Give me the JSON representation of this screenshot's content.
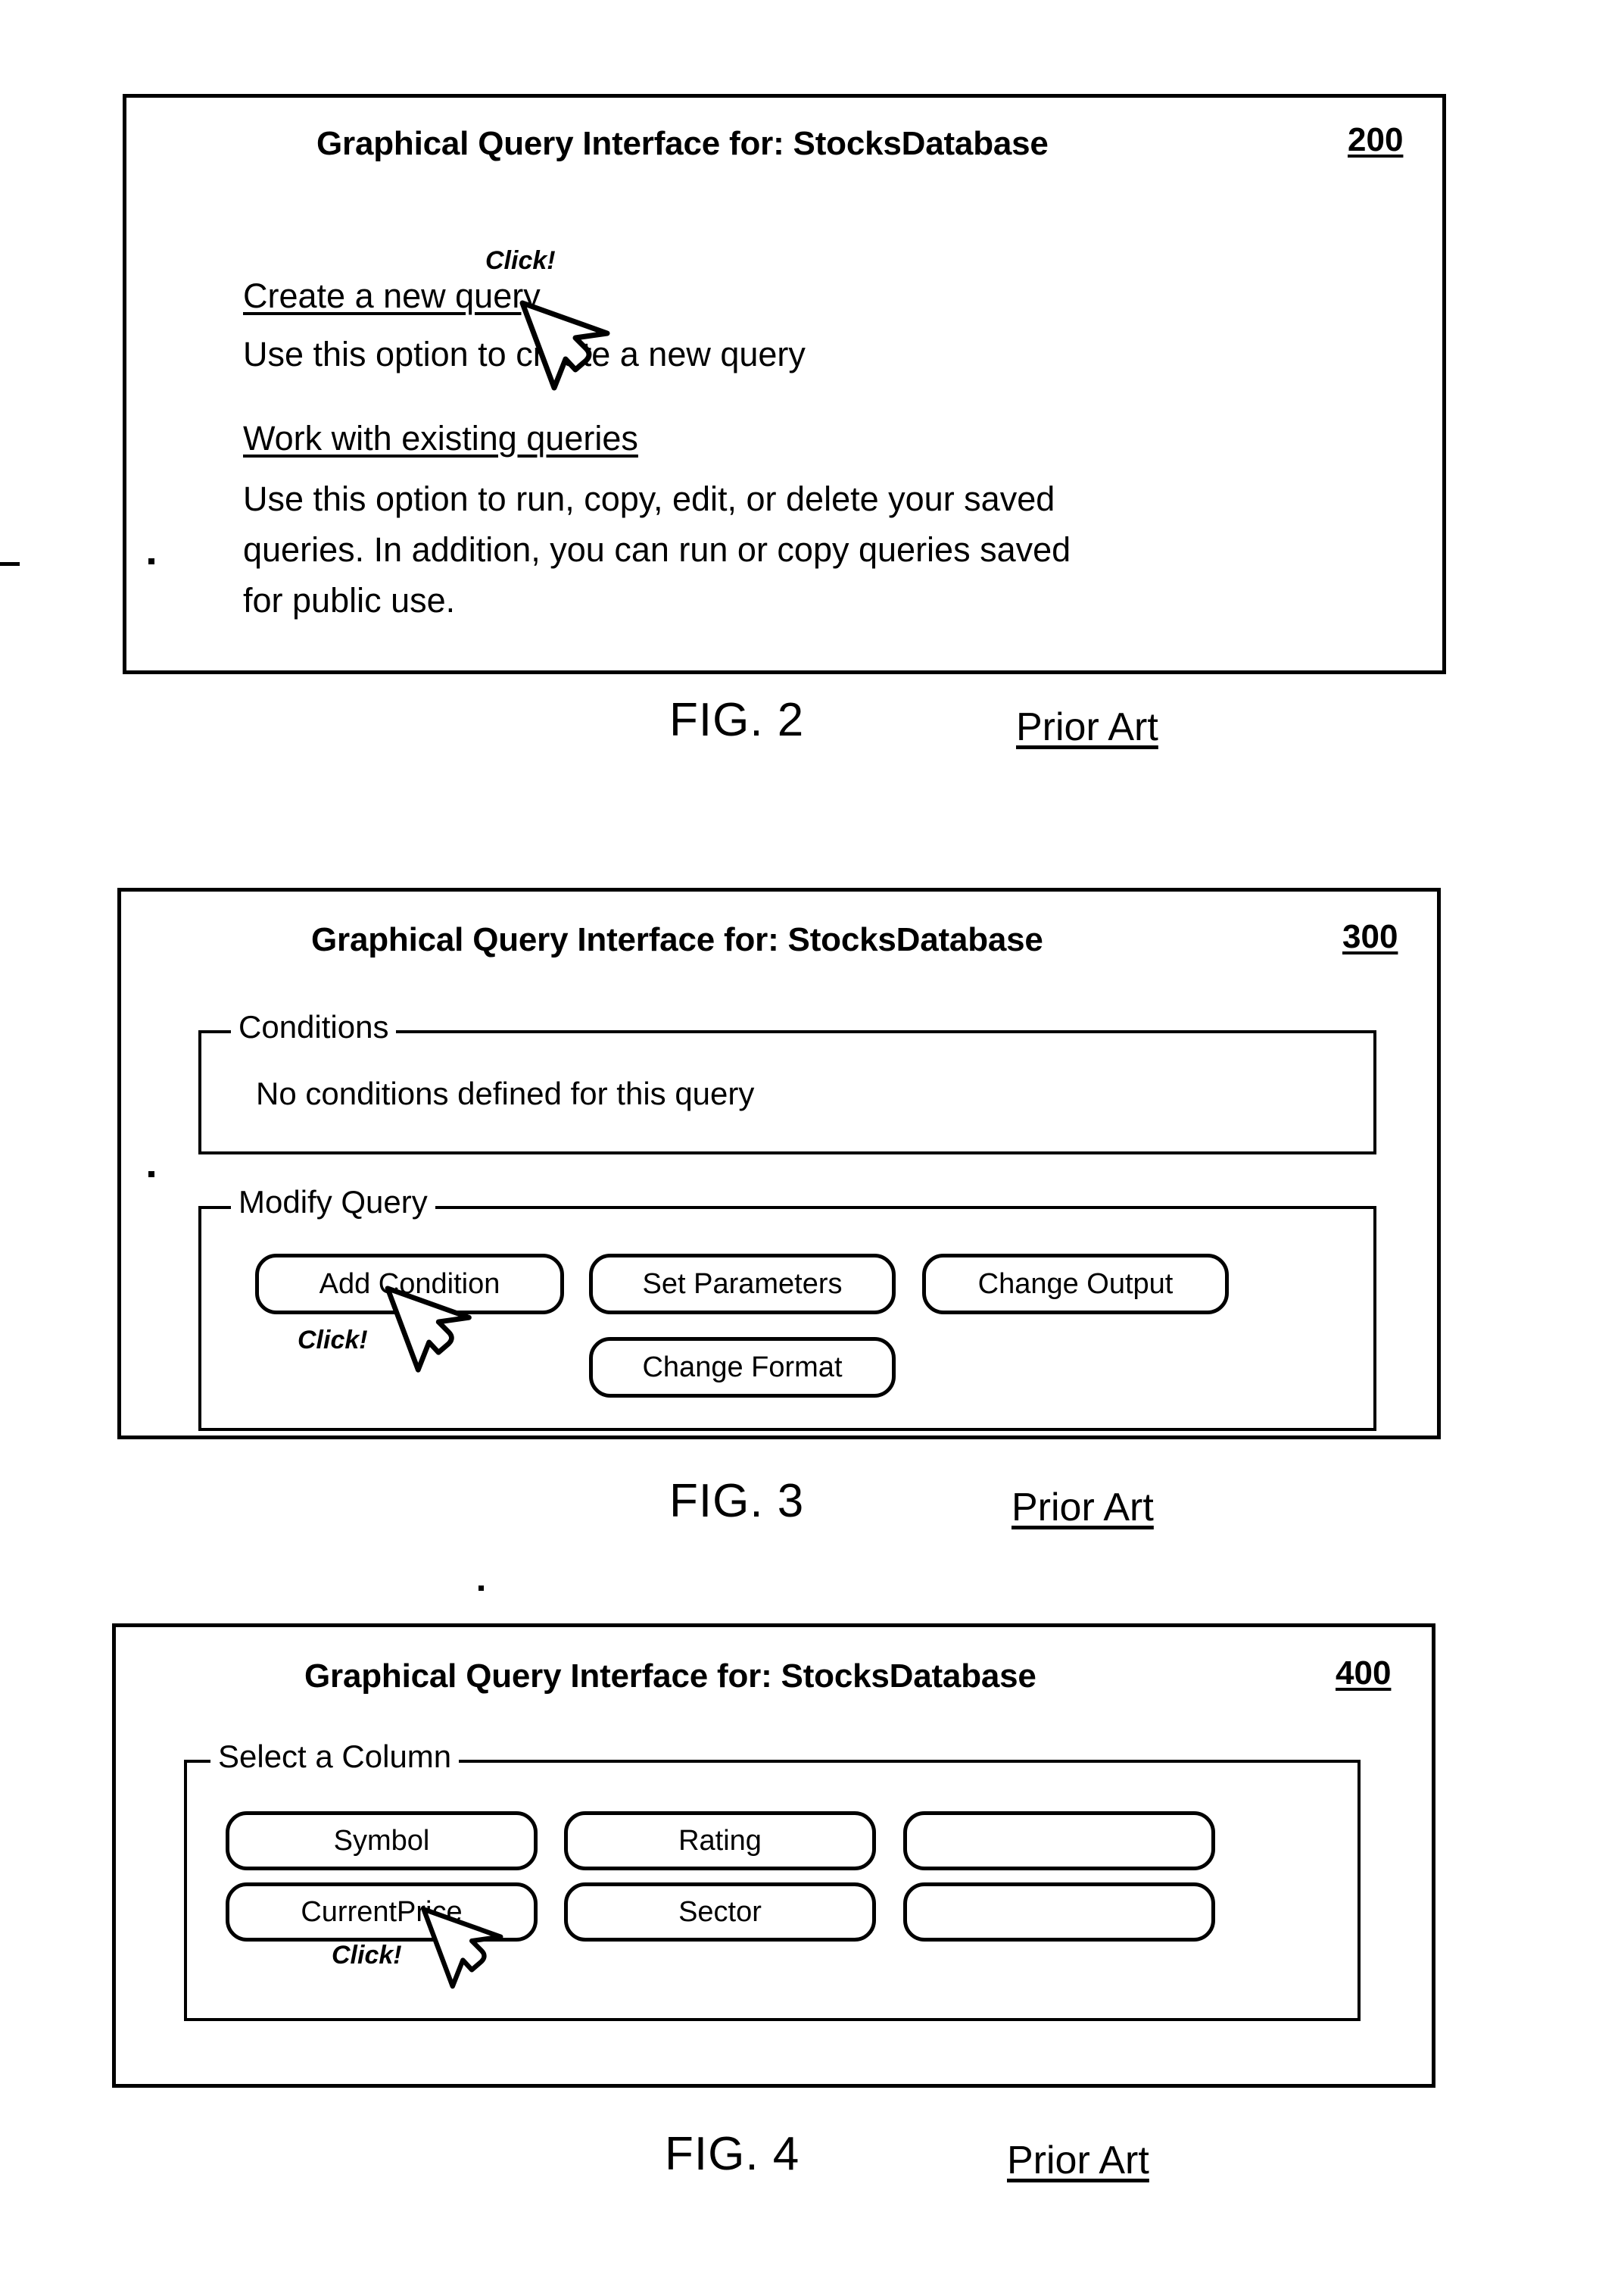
{
  "document": {
    "kind": "patent-drawing-sheet",
    "figures": [
      {
        "id": "fig2",
        "ref_number": "200",
        "caption": "FIG. 2",
        "caption_note": "Prior Art",
        "window_title": "Graphical Query Interface for:  StocksDatabase",
        "options": [
          {
            "link": "Create a new query",
            "description": "Use this option to create a new query"
          },
          {
            "link": "Work with existing queries",
            "description_lines": [
              "Use this option to run, copy, edit, or delete your saved",
              "queries.  In addition, you can run or copy queries saved",
              "for public use."
            ]
          }
        ],
        "cursor": {
          "label": "Click!",
          "target": "Create a new query"
        }
      },
      {
        "id": "fig3",
        "ref_number": "300",
        "caption": "FIG. 3",
        "caption_note": "Prior Art",
        "window_title": "Graphical Query Interface for:  StocksDatabase",
        "groups": [
          {
            "legend": "Conditions",
            "content": "No conditions defined for this query"
          },
          {
            "legend": "Modify Query",
            "buttons": [
              "Add Condition",
              "Set Parameters",
              "Change Output",
              "Change Format"
            ]
          }
        ],
        "cursor": {
          "label": "Click!",
          "target": "Add Condition"
        }
      },
      {
        "id": "fig4",
        "ref_number": "400",
        "caption": "FIG. 4",
        "caption_note": "Prior Art",
        "window_title": "Graphical Query Interface for:  StocksDatabase",
        "groups": [
          {
            "legend": "Select a Column",
            "buttons": [
              "Symbol",
              "Rating",
              "",
              "CurrentPrice",
              "Sector",
              ""
            ]
          }
        ],
        "cursor": {
          "label": "Click!",
          "target": "CurrentPrice"
        }
      }
    ]
  },
  "colors": {
    "ink": "#000000",
    "paper": "#ffffff"
  }
}
